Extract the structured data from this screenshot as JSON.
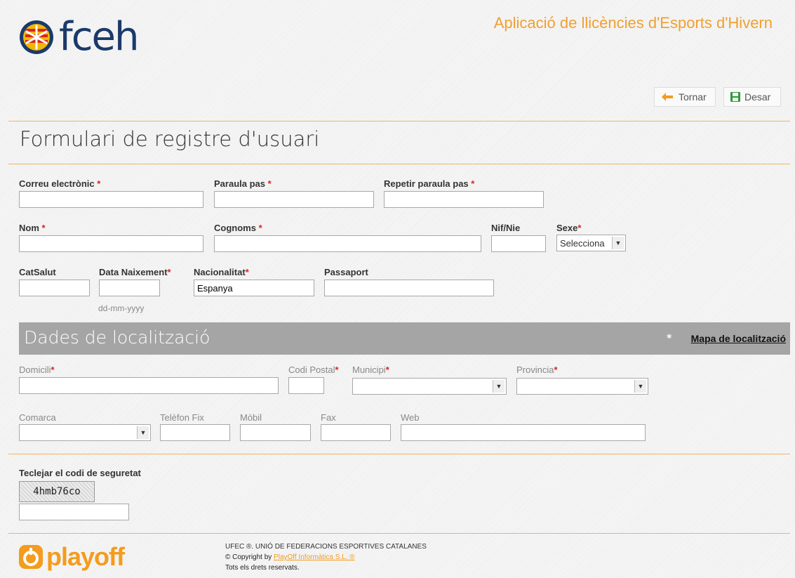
{
  "header": {
    "logo_text": "fceh",
    "app_title": "Aplicació de llicències d'Esports d'Hivern"
  },
  "toolbar": {
    "back_label": "Tornar",
    "save_label": "Desar"
  },
  "form": {
    "title": "Formulari de registre d'usuari",
    "email_label": "Correu electrònic",
    "password_label": "Paraula pas",
    "repeat_password_label": "Repetir paraula pas",
    "name_label": "Nom",
    "surname_label": "Cognoms",
    "nif_label": "Nif/Nie",
    "sex_label": "Sexe",
    "sex_value": "Selecciona",
    "catsalut_label": "CatSalut",
    "birth_label": "Data Naixement",
    "birth_hint": "dd-mm-yyyy",
    "nationality_label": "Nacionalitat",
    "nationality_value": "Espanya",
    "passport_label": "Passaport",
    "required_mark": "*"
  },
  "location": {
    "section_title": "Dades de localització",
    "map_link": "Mapa de localització",
    "map_star": "*",
    "address_label": "Domicili",
    "postal_label": "Codi Postal",
    "municipality_label": "Municipi",
    "province_label": "Provincia",
    "comarca_label": "Comarca",
    "phone_label": "Telèfon Fix",
    "mobile_label": "Mòbil",
    "fax_label": "Fax",
    "web_label": "Web"
  },
  "security": {
    "label": "Teclejar el codi de seguretat",
    "captcha_text": "4hmb76co"
  },
  "footer": {
    "brand": "playoff",
    "ufec_link": "UFEC ®. UNIÓ DE FEDERACIONS ESPORTIVES CATALANES",
    "copyright_prefix": "© Copyright by",
    "copyright_link": "PlayOff Informàtica S.L. ®",
    "rights": "Tots els drets reservats."
  },
  "colors": {
    "accent_orange": "#f0a030",
    "brand_blue": "#1b3a6b",
    "required_red": "#d9261c",
    "section_gray": "#a5a5a5"
  }
}
